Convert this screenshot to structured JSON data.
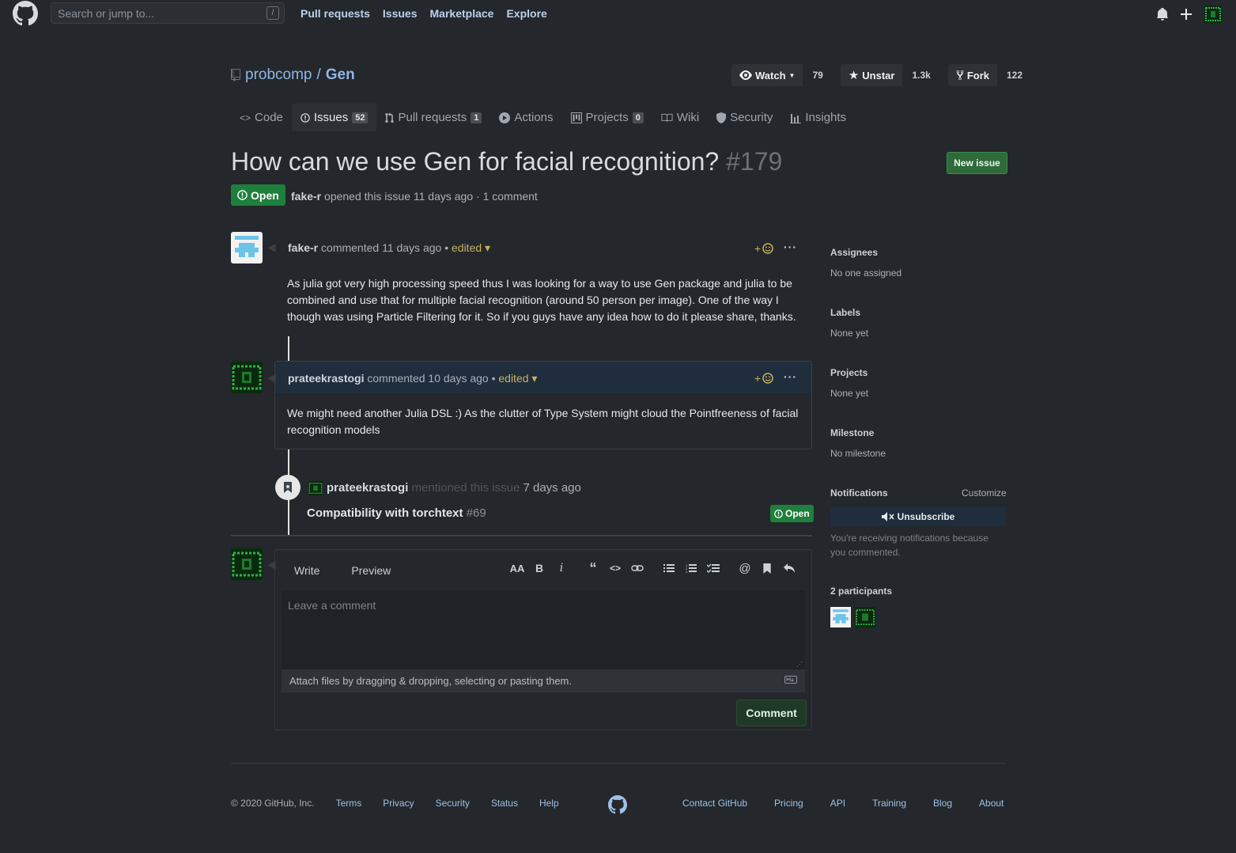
{
  "header": {
    "search_placeholder": "Search or jump to...",
    "search_shortcut": "/",
    "nav": [
      "Pull requests",
      "Issues",
      "Marketplace",
      "Explore"
    ]
  },
  "repo": {
    "owner": "probcomp",
    "separator": "/",
    "name": "Gen",
    "watch_label": "Watch",
    "watch_count": "79",
    "star_label": "Unstar",
    "star_count": "1.3k",
    "fork_label": "Fork",
    "fork_count": "122"
  },
  "tabs": [
    {
      "label": "Code"
    },
    {
      "label": "Issues",
      "count": "52"
    },
    {
      "label": "Pull requests",
      "count": "1"
    },
    {
      "label": "Actions"
    },
    {
      "label": "Projects",
      "count": "0"
    },
    {
      "label": "Wiki"
    },
    {
      "label": "Security"
    },
    {
      "label": "Insights"
    }
  ],
  "issue": {
    "title": "How can we use Gen for facial recognition?",
    "number": "#179",
    "new_issue_label": "New issue",
    "state": "Open",
    "author": "fake-r",
    "meta": "opened this issue 11 days ago · 1 comment"
  },
  "comments": [
    {
      "author": "fake-r",
      "action": "commented 11 days ago •",
      "edited": "edited",
      "body": "As julia got very high processing speed thus I was looking for a way to use Gen package and julia to be combined and use that for multiple facial recognition (around 50 person per image). One of the way I though was using Particle Filtering for it. So if you guys have any idea how to do it please share, thanks."
    },
    {
      "author": "prateekrastogi",
      "action": "commented 10 days ago •",
      "edited": "edited",
      "body": "We might need another Julia DSL :) As the clutter of Type System might cloud the Pointfreeness of facial recognition models"
    }
  ],
  "mention": {
    "user": "prateekrastogi",
    "action": "mentioned this issue",
    "time": "7 days ago",
    "ref_title": "Compatibility with torchtext",
    "ref_number": "#69",
    "ref_state": "Open"
  },
  "editor": {
    "write_tab": "Write",
    "preview_tab": "Preview",
    "placeholder": "Leave a comment",
    "attach_text": "Attach files by dragging & dropping, selecting or pasting them.",
    "submit_label": "Comment"
  },
  "sidebar": {
    "assignees_label": "Assignees",
    "assignees_value": "No one assigned",
    "labels_label": "Labels",
    "labels_value": "None yet",
    "projects_label": "Projects",
    "projects_value": "None yet",
    "milestone_label": "Milestone",
    "milestone_value": "No milestone",
    "notifications_label": "Notifications",
    "customize_label": "Customize",
    "unsubscribe_label": "Unsubscribe",
    "notification_note": "You're receiving notifications because you commented.",
    "participants_label": "2 participants"
  },
  "footer": {
    "copyright": "© 2020 GitHub, Inc.",
    "left_links": [
      "Terms",
      "Privacy",
      "Security",
      "Status",
      "Help"
    ],
    "right_links": [
      "Contact GitHub",
      "Pricing",
      "API",
      "Training",
      "Blog",
      "About"
    ]
  }
}
